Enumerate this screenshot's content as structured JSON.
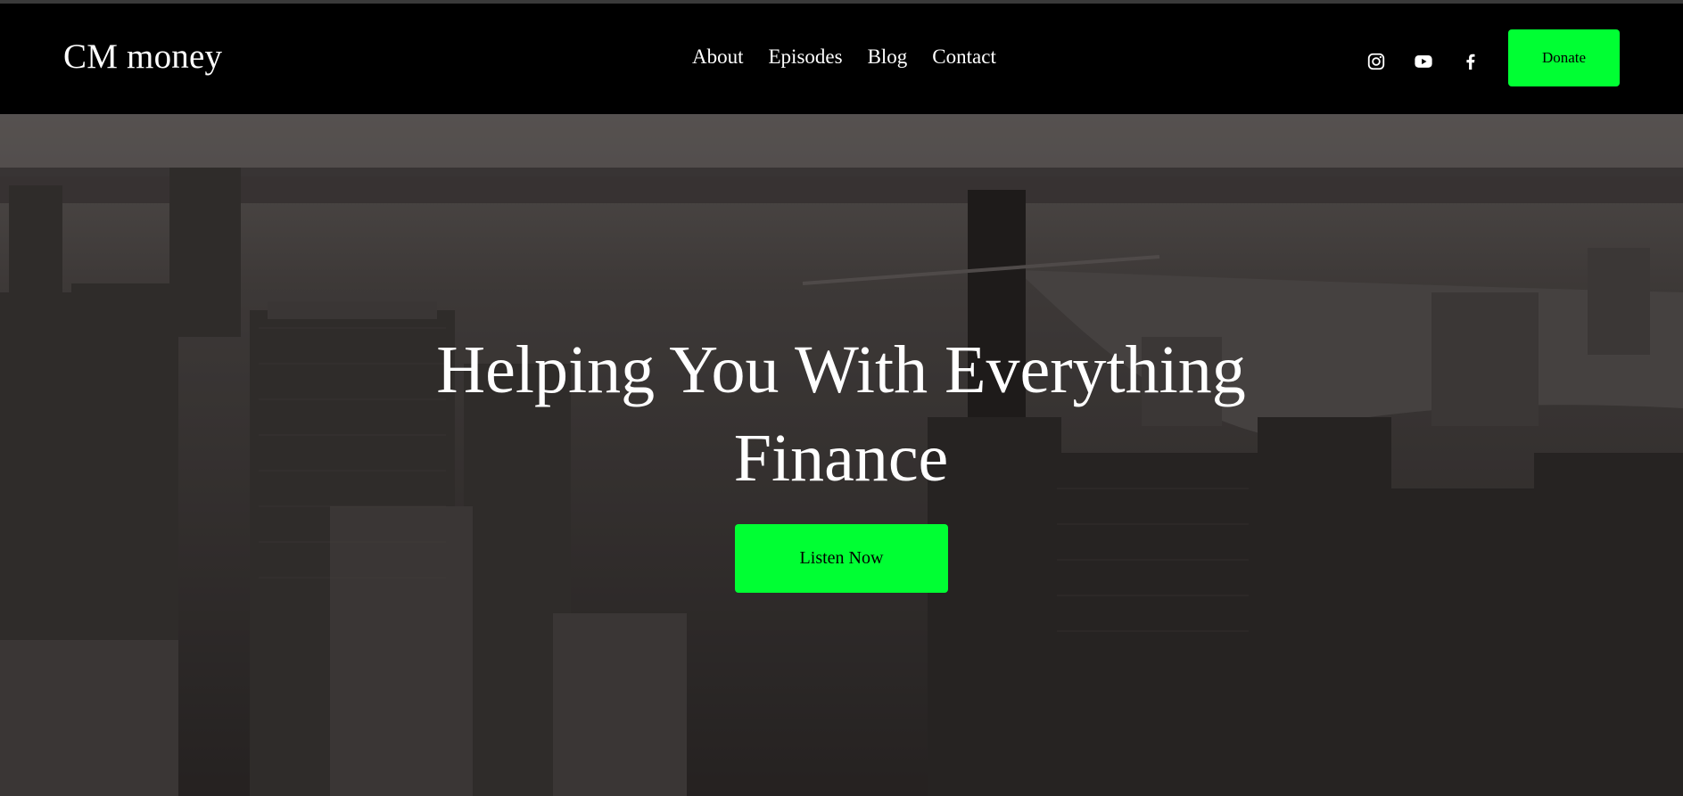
{
  "header": {
    "logo": "CM money",
    "nav": [
      "About",
      "Episodes",
      "Blog",
      "Contact"
    ],
    "social_icons": [
      "instagram-icon",
      "youtube-icon",
      "facebook-icon"
    ],
    "donate_label": "Donate"
  },
  "hero": {
    "title_line1": "Helping You With Everything",
    "title_line2": "Finance",
    "cta_label": "Listen Now",
    "background": "aerial city skyline photo"
  },
  "colors": {
    "accent": "#00ff33",
    "header_bg": "#000000",
    "text": "#ffffff"
  }
}
